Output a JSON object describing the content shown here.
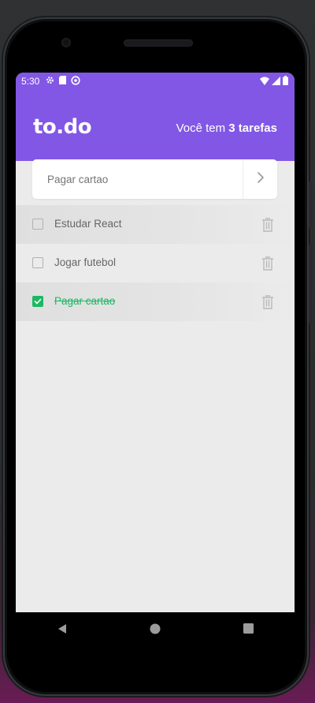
{
  "statusbar": {
    "time": "5:30",
    "icons": [
      "gear-icon",
      "sd-card-icon",
      "no-disturb-icon",
      "wifi-icon",
      "signal-icon",
      "battery-icon"
    ]
  },
  "header": {
    "logo": "to.do",
    "count_prefix": "Você tem ",
    "count_value": "3 tarefas"
  },
  "input": {
    "value": "",
    "placeholder": "Pagar cartao"
  },
  "tasks": [
    {
      "label": "Estudar React",
      "done": false
    },
    {
      "label": "Jogar futebol",
      "done": false
    },
    {
      "label": "Pagar cartao",
      "done": true
    }
  ],
  "colors": {
    "brand": "#8257e5",
    "done": "#1db863",
    "background": "#ebebeb",
    "text": "#666666"
  },
  "navigation": [
    "back-icon",
    "home-icon",
    "recents-icon"
  ]
}
